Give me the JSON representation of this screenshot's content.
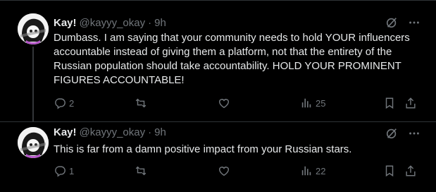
{
  "tweets": [
    {
      "name": "Kay!",
      "handle": "@kayyy_okay",
      "separator": "·",
      "time": "9h",
      "text": "Dumbass. I am saying that your community needs to hold YOUR influencers accountable instead of giving them a platform, not that the entirety of the Russian population should take accountability. HOLD YOUR PROMINENT FIGURES ACCOUNTABLE!",
      "replies": "2",
      "reposts": "",
      "likes": "",
      "views": "25",
      "icons": [
        "grok-icon",
        "more-icon",
        "reply-icon",
        "repost-icon",
        "like-icon",
        "views-icon",
        "bookmark-icon",
        "share-icon"
      ]
    },
    {
      "name": "Kay!",
      "handle": "@kayyy_okay",
      "separator": "·",
      "time": "9h",
      "text": "This is far from a damn positive impact from your Russian stars.",
      "replies": "1",
      "reposts": "",
      "likes": "",
      "views": "22",
      "icons": [
        "grok-icon",
        "more-icon",
        "reply-icon",
        "repost-icon",
        "like-icon",
        "views-icon",
        "bookmark-icon",
        "share-icon"
      ]
    }
  ],
  "colors": {
    "background": "#000000",
    "text": "#e7e9ea",
    "secondary": "#71767b",
    "divider": "#2f3336"
  }
}
